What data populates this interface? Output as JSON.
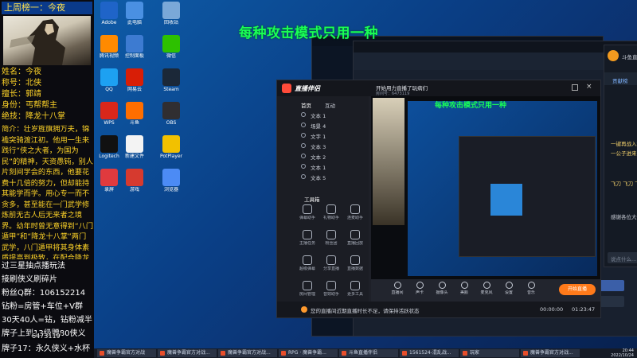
{
  "overlay": {
    "top_rank": "上周榜一：今夜",
    "info_lines": [
      {
        "label": "姓名：",
        "value": "今夜"
      },
      {
        "label": "称号：",
        "value": "北侠"
      },
      {
        "label": "擅长：",
        "value": "郭靖"
      },
      {
        "label": "身份：",
        "value": "丐帮帮主"
      },
      {
        "label": "绝技：",
        "value": "降龙十八掌"
      }
    ],
    "intro": "简介：壮岁旌旗拥万夫，锦襜突骑渡江初。他用一生来践行“侠之大者，为国为民”的精神，天资愚钝，别人片刻间学会的东西，他要花费十几倍的努力，但却能持其能学而学。用心专一而不贪多，甚至能在一门武学修炼前无古人后无来者之境界。幼年时曾无意得到“八门遁甲”和“降龙十八掌”两门武学，八门遁甲将其身体素质提高到极致，在配合降龙十八掌十八掌招出，威力强大到仿佛山河破碎摧枯拉朽。",
    "bottom_lines": [
      "过三星抽点播玩法",
      "接刷侠义刷碎片",
      "粉丝Q群：106152214",
      "钻粉=房管+车位+V群",
      "30天40人=钻，钻粉减半",
      "牌子上到13级赠80侠义",
      "牌子17：永久侠义+水杯"
    ],
    "room_id": "6473119"
  },
  "banner": "每种攻击模式只用一种",
  "desktop_icons": [
    {
      "label": "Adobe",
      "color": "#1f64c8"
    },
    {
      "label": "此电脑",
      "color": "#4a90e2"
    },
    {
      "label": "回收站",
      "color": "#7aa8d8"
    },
    {
      "label": "腾讯视频",
      "color": "#ff8a00"
    },
    {
      "label": "控制面板",
      "color": "#3d7bd1"
    },
    {
      "label": "微信",
      "color": "#2dc100"
    },
    {
      "label": "QQ",
      "color": "#1da1f2"
    },
    {
      "label": "网易云",
      "color": "#d81e06"
    },
    {
      "label": "Steam",
      "color": "#1b2838"
    },
    {
      "label": "WPS",
      "color": "#d9271a"
    },
    {
      "label": "斗鱼",
      "color": "#ff6e00"
    },
    {
      "label": "OBS",
      "color": "#302e31"
    },
    {
      "label": "Logitech",
      "color": "#111111"
    },
    {
      "label": "新建文件",
      "color": "#f3f3f3"
    },
    {
      "label": "PotPlayer",
      "color": "#f2c100"
    },
    {
      "label": "录屏",
      "color": "#e03a3e"
    },
    {
      "label": "游戏",
      "color": "#d63a2f"
    },
    {
      "label": "浏览器",
      "color": "#4c8bf5"
    }
  ],
  "live_window": {
    "title": "直播伴侣",
    "stream_title": "开始用力直播了玩病们",
    "room_label": "房间号：6473119",
    "tabs": [
      "首页",
      "互动"
    ],
    "scenes": [
      "文本 1",
      "场景 4",
      "文字 1",
      "文本 3",
      "文本 2",
      "文本 1",
      "文本 5"
    ],
    "tools_title": "工具箱",
    "tools": [
      "弹幕助手",
      "礼物助手",
      "连麦助手",
      "主播任务",
      "粉丝团",
      "直播回放",
      "超级弹幕",
      "分享直播",
      "直播数据",
      "房间管理",
      "音效助手",
      "更多工具"
    ],
    "controls": [
      "直播间",
      "声卡",
      "摄像头",
      "美颜",
      "麦克风",
      "设置",
      "音乐"
    ],
    "start_button": "开始直播",
    "time_left": "00:00:00",
    "time_right": "01:23:47",
    "warning": "您的直播间近期直播时长不足，请保持活跃状态"
  },
  "side_panel": {
    "title": "斗鱼直播间",
    "tab": "贡献榜",
    "chat_lines": [
      "一键再战入场 😊",
      "一公子进来了",
      "飞刀 飞刀 飞刀",
      "感谢各位大佬支持"
    ],
    "input_placeholder": "说点什么..."
  },
  "taskbar": {
    "items": [
      "魔兽争霸官方对战",
      "魔兽争霸官方对战...",
      "魔兽争霸官方对战...",
      "RPG · 魔兽争霸...",
      "斗鱼直播伴侣",
      "1561524-混乱战...",
      "玩家",
      "魔兽争霸官方对战..."
    ],
    "clock_time": "20:44",
    "clock_date": "2022/10/24"
  }
}
